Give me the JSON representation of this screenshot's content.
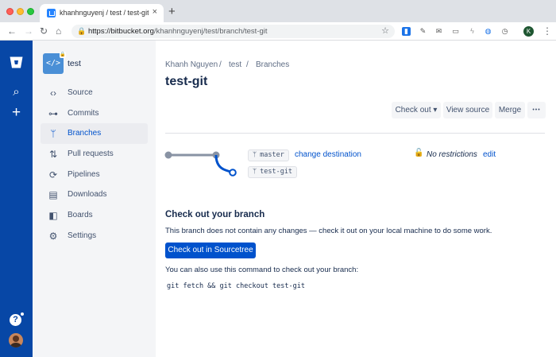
{
  "browser": {
    "tab_title": "khanhnguyenj / test / test-git",
    "tab_close": "×",
    "new_tab": "+",
    "url_host": "https://bitbucket.org",
    "url_path": "/khanhnguyenj/test/branch/test-git",
    "profile_initial": "K"
  },
  "global_nav": {
    "help": "?",
    "accent": "#0747a6"
  },
  "repo": {
    "name": "test",
    "avatar_glyph": "</>"
  },
  "sidebar": {
    "items": [
      {
        "label": "Source",
        "icon": "code-icon"
      },
      {
        "label": "Commits",
        "icon": "commits-icon"
      },
      {
        "label": "Branches",
        "icon": "branch-icon",
        "active": true
      },
      {
        "label": "Pull requests",
        "icon": "pull-request-icon"
      },
      {
        "label": "Pipelines",
        "icon": "pipelines-icon"
      },
      {
        "label": "Downloads",
        "icon": "downloads-icon"
      },
      {
        "label": "Boards",
        "icon": "boards-icon"
      },
      {
        "label": "Settings",
        "icon": "gear-icon"
      }
    ]
  },
  "breadcrumb": {
    "owner": "Khanh Nguyen",
    "repo": "test",
    "section": "Branches",
    "separator": "/"
  },
  "page": {
    "title": "test-git"
  },
  "toolbar": {
    "checkout_label": "Check out ▾",
    "view_source_label": "View source",
    "merge_label": "Merge",
    "more_label": "•••"
  },
  "branch_info": {
    "target_branch": "master",
    "source_branch": "test-git",
    "change_destination": "change destination",
    "restrictions": "No restrictions",
    "edit": "edit"
  },
  "checkout_section": {
    "title": "Check out your branch",
    "description": "This branch does not contain any changes — check it out on your local machine to do some work.",
    "sourcetree_button": "Check out in Sourcetree",
    "command_intro": "You can also use this command to check out your branch:",
    "command": "git fetch && git checkout test-git"
  }
}
